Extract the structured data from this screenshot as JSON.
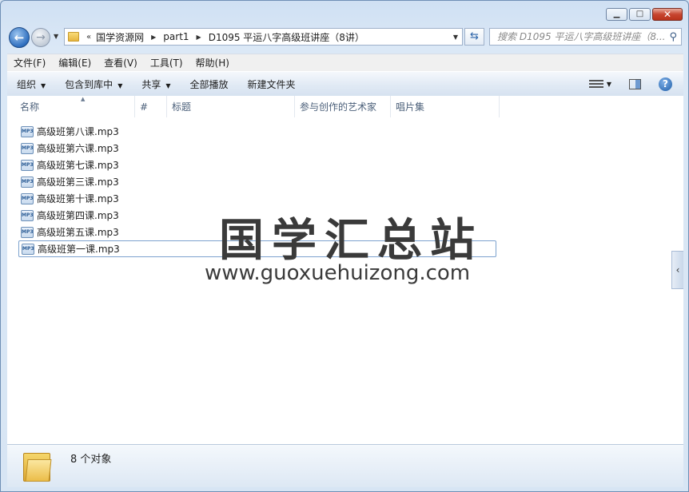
{
  "window": {
    "caption_buttons": {
      "minimize": "▭",
      "maximize": "▫",
      "close": "✕"
    }
  },
  "address_bar": {
    "overflow": "«",
    "segments": [
      "国学资源网",
      "part1",
      "D1095 平运八字高级班讲座（8讲）"
    ]
  },
  "search": {
    "placeholder": "搜索 D1095 平运八字高级班讲座（8..."
  },
  "menu": [
    "文件(F)",
    "编辑(E)",
    "查看(V)",
    "工具(T)",
    "帮助(H)"
  ],
  "toolbar": {
    "organize": "组织",
    "include_in_library": "包含到库中",
    "share": "共享",
    "play_all": "全部播放",
    "new_folder": "新建文件夹"
  },
  "columns": [
    "名称",
    "#",
    "标题",
    "参与创作的艺术家",
    "唱片集"
  ],
  "files": [
    {
      "name": "高级班第八课.mp3",
      "icon": "mp3-file-icon"
    },
    {
      "name": "高级班第六课.mp3",
      "icon": "mp3-file-icon"
    },
    {
      "name": "高级班第七课.mp3",
      "icon": "mp3-file-icon"
    },
    {
      "name": "高级班第三课.mp3",
      "icon": "mp3-file-icon"
    },
    {
      "name": "高级班第十课.mp3",
      "icon": "mp3-file-icon"
    },
    {
      "name": "高级班第四课.mp3",
      "icon": "mp3-file-icon"
    },
    {
      "name": "高级班第五课.mp3",
      "icon": "mp3-file-icon"
    },
    {
      "name": "高级班第一课.mp3",
      "icon": "mp3-file-icon",
      "selected": true
    }
  ],
  "watermark": {
    "title": "国学汇总站",
    "url": "www.guoxuehuizong.com"
  },
  "details": {
    "item_count": "8 个对象"
  },
  "colors": {
    "selection_border": "#7da2ce",
    "window_frame": "#d7e5f4"
  }
}
